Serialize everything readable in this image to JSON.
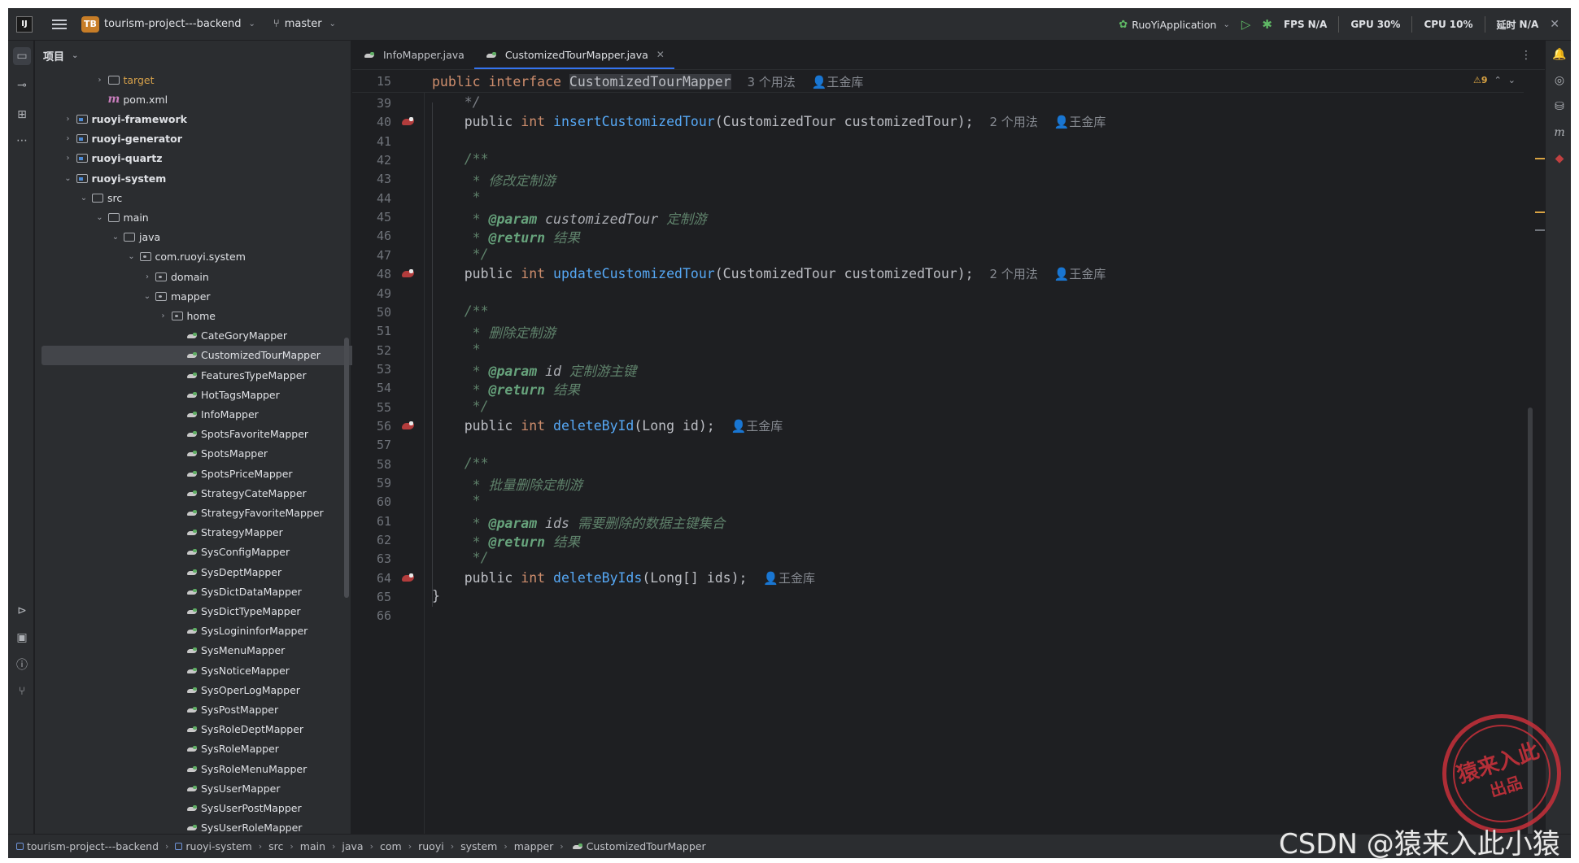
{
  "titlebar": {
    "project_badge": "TB",
    "project_name": "tourism-project---backend",
    "branch": "master",
    "run_config": "RuoYiApplication",
    "fps_label": "FPS",
    "fps_value": "N/A",
    "gpu_label": "GPU",
    "gpu_value": "30%",
    "cpu_label": "CPU",
    "cpu_value": "10%",
    "latency_label": "延时",
    "latency_value": "N/A"
  },
  "project_panel": {
    "title": "项目",
    "tree": [
      {
        "label": "target",
        "indent": 3,
        "chev": "›",
        "icon": "folder",
        "style": "orange"
      },
      {
        "label": "pom.xml",
        "indent": 3,
        "chev": "",
        "icon": "maven",
        "style": ""
      },
      {
        "label": "ruoyi-framework",
        "indent": 1,
        "chev": "›",
        "icon": "module",
        "style": "bold"
      },
      {
        "label": "ruoyi-generator",
        "indent": 1,
        "chev": "›",
        "icon": "module",
        "style": "bold"
      },
      {
        "label": "ruoyi-quartz",
        "indent": 1,
        "chev": "›",
        "icon": "module",
        "style": "bold"
      },
      {
        "label": "ruoyi-system",
        "indent": 1,
        "chev": "⌄",
        "icon": "module",
        "style": "bold"
      },
      {
        "label": "src",
        "indent": 2,
        "chev": "⌄",
        "icon": "folder",
        "style": ""
      },
      {
        "label": "main",
        "indent": 3,
        "chev": "⌄",
        "icon": "folder",
        "style": ""
      },
      {
        "label": "java",
        "indent": 4,
        "chev": "⌄",
        "icon": "folder",
        "style": ""
      },
      {
        "label": "com.ruoyi.system",
        "indent": 5,
        "chev": "⌄",
        "icon": "package",
        "style": ""
      },
      {
        "label": "domain",
        "indent": 6,
        "chev": "›",
        "icon": "package",
        "style": ""
      },
      {
        "label": "mapper",
        "indent": 6,
        "chev": "⌄",
        "icon": "package",
        "style": ""
      },
      {
        "label": "home",
        "indent": 7,
        "chev": "›",
        "icon": "package",
        "style": ""
      },
      {
        "label": "CateGoryMapper",
        "indent": 8,
        "chev": "",
        "icon": "mapper",
        "style": ""
      },
      {
        "label": "CustomizedTourMapper",
        "indent": 8,
        "chev": "",
        "icon": "mapper",
        "style": "selected"
      },
      {
        "label": "FeaturesTypeMapper",
        "indent": 8,
        "chev": "",
        "icon": "mapper",
        "style": ""
      },
      {
        "label": "HotTagsMapper",
        "indent": 8,
        "chev": "",
        "icon": "mapper",
        "style": ""
      },
      {
        "label": "InfoMapper",
        "indent": 8,
        "chev": "",
        "icon": "mapper",
        "style": ""
      },
      {
        "label": "SpotsFavoriteMapper",
        "indent": 8,
        "chev": "",
        "icon": "mapper",
        "style": ""
      },
      {
        "label": "SpotsMapper",
        "indent": 8,
        "chev": "",
        "icon": "mapper",
        "style": ""
      },
      {
        "label": "SpotsPriceMapper",
        "indent": 8,
        "chev": "",
        "icon": "mapper",
        "style": ""
      },
      {
        "label": "StrategyCateMapper",
        "indent": 8,
        "chev": "",
        "icon": "mapper",
        "style": ""
      },
      {
        "label": "StrategyFavoriteMapper",
        "indent": 8,
        "chev": "",
        "icon": "mapper",
        "style": ""
      },
      {
        "label": "StrategyMapper",
        "indent": 8,
        "chev": "",
        "icon": "mapper",
        "style": ""
      },
      {
        "label": "SysConfigMapper",
        "indent": 8,
        "chev": "",
        "icon": "mapper",
        "style": ""
      },
      {
        "label": "SysDeptMapper",
        "indent": 8,
        "chev": "",
        "icon": "mapper",
        "style": ""
      },
      {
        "label": "SysDictDataMapper",
        "indent": 8,
        "chev": "",
        "icon": "mapper",
        "style": ""
      },
      {
        "label": "SysDictTypeMapper",
        "indent": 8,
        "chev": "",
        "icon": "mapper",
        "style": ""
      },
      {
        "label": "SysLogininforMapper",
        "indent": 8,
        "chev": "",
        "icon": "mapper",
        "style": ""
      },
      {
        "label": "SysMenuMapper",
        "indent": 8,
        "chev": "",
        "icon": "mapper",
        "style": ""
      },
      {
        "label": "SysNoticeMapper",
        "indent": 8,
        "chev": "",
        "icon": "mapper",
        "style": ""
      },
      {
        "label": "SysOperLogMapper",
        "indent": 8,
        "chev": "",
        "icon": "mapper",
        "style": ""
      },
      {
        "label": "SysPostMapper",
        "indent": 8,
        "chev": "",
        "icon": "mapper",
        "style": ""
      },
      {
        "label": "SysRoleDeptMapper",
        "indent": 8,
        "chev": "",
        "icon": "mapper",
        "style": ""
      },
      {
        "label": "SysRoleMapper",
        "indent": 8,
        "chev": "",
        "icon": "mapper",
        "style": ""
      },
      {
        "label": "SysRoleMenuMapper",
        "indent": 8,
        "chev": "",
        "icon": "mapper",
        "style": ""
      },
      {
        "label": "SysUserMapper",
        "indent": 8,
        "chev": "",
        "icon": "mapper",
        "style": ""
      },
      {
        "label": "SysUserPostMapper",
        "indent": 8,
        "chev": "",
        "icon": "mapper",
        "style": ""
      },
      {
        "label": "SysUserRoleMapper",
        "indent": 8,
        "chev": "",
        "icon": "mapper",
        "style": ""
      }
    ]
  },
  "editor": {
    "tabs": [
      {
        "label": "InfoMapper.java",
        "active": false
      },
      {
        "label": "CustomizedTourMapper.java",
        "active": true
      }
    ],
    "warnings": "⚠9",
    "sticky": {
      "line": "15",
      "kw1": "public",
      "kw2": "interface",
      "name": "CustomizedTourMapper",
      "usages": "3 个用法",
      "author": "王金库"
    },
    "lines": [
      {
        "n": "39",
        "gutter": false,
        "tokens": [
          [
            "cm",
            "    */"
          ]
        ]
      },
      {
        "n": "40",
        "gutter": true,
        "tokens": [
          [
            "",
            "    public "
          ],
          [
            "kw",
            "int "
          ],
          [
            "fn",
            "insertCustomizedTour"
          ],
          [
            "",
            "(CustomizedTour customizedTour);  "
          ],
          [
            "hint",
            "2 个用法"
          ],
          [
            "",
            "  "
          ],
          [
            "author",
            "👤王金库"
          ]
        ]
      },
      {
        "n": "41",
        "gutter": false,
        "tokens": []
      },
      {
        "n": "42",
        "gutter": false,
        "tokens": [
          [
            "doc",
            "    /**"
          ]
        ]
      },
      {
        "n": "43",
        "gutter": false,
        "tokens": [
          [
            "doc",
            "     * 修改定制游"
          ]
        ]
      },
      {
        "n": "44",
        "gutter": false,
        "tokens": [
          [
            "doc",
            "     *"
          ]
        ]
      },
      {
        "n": "45",
        "gutter": false,
        "tokens": [
          [
            "doc",
            "     * "
          ],
          [
            "tag",
            "@param "
          ],
          [
            "param",
            "customizedTour "
          ],
          [
            "doc",
            "定制游"
          ]
        ]
      },
      {
        "n": "46",
        "gutter": false,
        "tokens": [
          [
            "doc",
            "     * "
          ],
          [
            "tag",
            "@return "
          ],
          [
            "doc",
            "结果"
          ]
        ]
      },
      {
        "n": "47",
        "gutter": false,
        "tokens": [
          [
            "doc",
            "     */"
          ]
        ]
      },
      {
        "n": "48",
        "gutter": true,
        "tokens": [
          [
            "",
            "    public "
          ],
          [
            "kw",
            "int "
          ],
          [
            "fn",
            "updateCustomizedTour"
          ],
          [
            "",
            "(CustomizedTour customizedTour);  "
          ],
          [
            "hint",
            "2 个用法"
          ],
          [
            "",
            "  "
          ],
          [
            "author",
            "👤王金库"
          ]
        ]
      },
      {
        "n": "49",
        "gutter": false,
        "tokens": []
      },
      {
        "n": "50",
        "gutter": false,
        "tokens": [
          [
            "doc",
            "    /**"
          ]
        ]
      },
      {
        "n": "51",
        "gutter": false,
        "tokens": [
          [
            "doc",
            "     * 删除定制游"
          ]
        ]
      },
      {
        "n": "52",
        "gutter": false,
        "tokens": [
          [
            "doc",
            "     *"
          ]
        ]
      },
      {
        "n": "53",
        "gutter": false,
        "tokens": [
          [
            "doc",
            "     * "
          ],
          [
            "tag",
            "@param "
          ],
          [
            "param",
            "id "
          ],
          [
            "doc",
            "定制游主键"
          ]
        ]
      },
      {
        "n": "54",
        "gutter": false,
        "tokens": [
          [
            "doc",
            "     * "
          ],
          [
            "tag",
            "@return "
          ],
          [
            "doc",
            "结果"
          ]
        ]
      },
      {
        "n": "55",
        "gutter": false,
        "tokens": [
          [
            "doc",
            "     */"
          ]
        ]
      },
      {
        "n": "56",
        "gutter": true,
        "tokens": [
          [
            "",
            "    public "
          ],
          [
            "kw",
            "int "
          ],
          [
            "fn",
            "deleteById"
          ],
          [
            "",
            "(Long id);  "
          ],
          [
            "author",
            "👤王金库"
          ]
        ]
      },
      {
        "n": "57",
        "gutter": false,
        "tokens": []
      },
      {
        "n": "58",
        "gutter": false,
        "tokens": [
          [
            "doc",
            "    /**"
          ]
        ]
      },
      {
        "n": "59",
        "gutter": false,
        "tokens": [
          [
            "doc",
            "     * 批量删除定制游"
          ]
        ]
      },
      {
        "n": "60",
        "gutter": false,
        "tokens": [
          [
            "doc",
            "     *"
          ]
        ]
      },
      {
        "n": "61",
        "gutter": false,
        "tokens": [
          [
            "doc",
            "     * "
          ],
          [
            "tag",
            "@param "
          ],
          [
            "param",
            "ids "
          ],
          [
            "doc",
            "需要删除的数据主键集合"
          ]
        ]
      },
      {
        "n": "62",
        "gutter": false,
        "tokens": [
          [
            "doc",
            "     * "
          ],
          [
            "tag",
            "@return "
          ],
          [
            "doc",
            "结果"
          ]
        ]
      },
      {
        "n": "63",
        "gutter": false,
        "tokens": [
          [
            "doc",
            "     */"
          ]
        ]
      },
      {
        "n": "64",
        "gutter": true,
        "tokens": [
          [
            "",
            "    public "
          ],
          [
            "kw",
            "int "
          ],
          [
            "fn",
            "deleteByIds"
          ],
          [
            "",
            "(Long[] ids);  "
          ],
          [
            "author",
            "👤王金库"
          ]
        ]
      },
      {
        "n": "65",
        "gutter": false,
        "tokens": [
          [
            "",
            "}"
          ]
        ]
      },
      {
        "n": "66",
        "gutter": false,
        "tokens": []
      }
    ]
  },
  "statusbar": {
    "crumbs": [
      "tourism-project---backend",
      "ruoyi-system",
      "src",
      "main",
      "java",
      "com",
      "ruoyi",
      "system",
      "mapper",
      "CustomizedTourMapper"
    ]
  },
  "watermark": {
    "stamp_text": "猿来入此",
    "stamp_sub": "出品",
    "csdn": "CSDN @猿来入此小猿"
  }
}
